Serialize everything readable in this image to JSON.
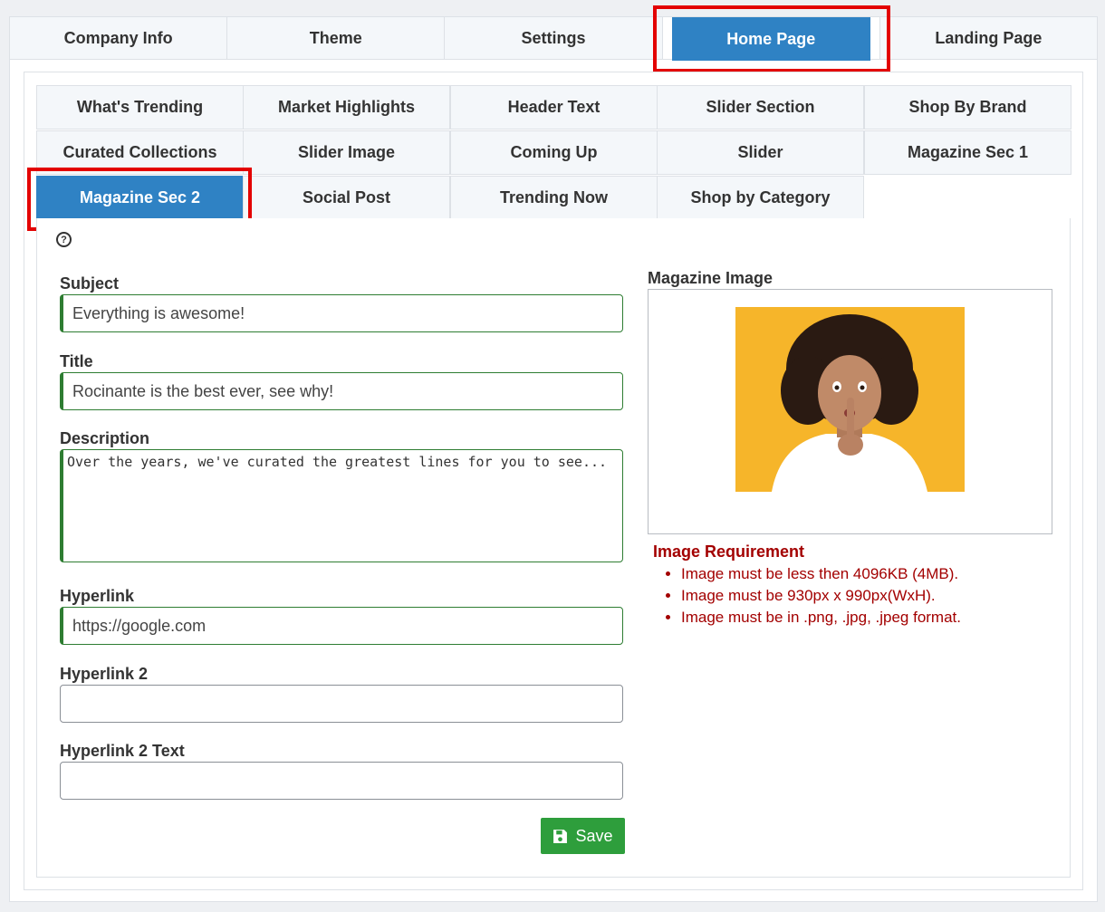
{
  "top_tabs": [
    "Company Info",
    "Theme",
    "Settings",
    "Home Page",
    "Landing Page"
  ],
  "sub_tabs": [
    "What's Trending",
    "Market Highlights",
    "Header Text",
    "Slider Section",
    "Shop By Brand",
    "Curated Collections",
    "Slider Image",
    "Coming Up",
    "Slider",
    "Magazine Sec 1",
    "Magazine Sec 2",
    "Social Post",
    "Trending Now",
    "Shop by Category"
  ],
  "help_icon": "?",
  "form": {
    "subject_label": "Subject",
    "subject_value": "Everything is awesome!",
    "title_label": "Title",
    "title_value": "Rocinante is the best ever, see why!",
    "description_label": "Description",
    "description_value": "Over the years, we've curated the greatest lines for you to see...",
    "hyperlink_label": "Hyperlink",
    "hyperlink_value": "https://google.com",
    "hyperlink2_label": "Hyperlink 2",
    "hyperlink2_value": "",
    "hyperlink2_text_label": "Hyperlink 2 Text",
    "hyperlink2_text_value": "",
    "save_label": "Save"
  },
  "image_section": {
    "label": "Magazine Image",
    "requirement_title": "Image Requirement",
    "requirements": [
      "Image must be less then 4096KB (4MB).",
      "Image must be 930px x 990px(WxH).",
      "Image must be in .png, .jpg, .jpeg format."
    ]
  },
  "colors": {
    "active_tab": "#2f82c4",
    "highlight": "#e30000",
    "save_button": "#2e9e3c",
    "requirement_text": "#a30000",
    "field_border": "#2e7d32"
  }
}
